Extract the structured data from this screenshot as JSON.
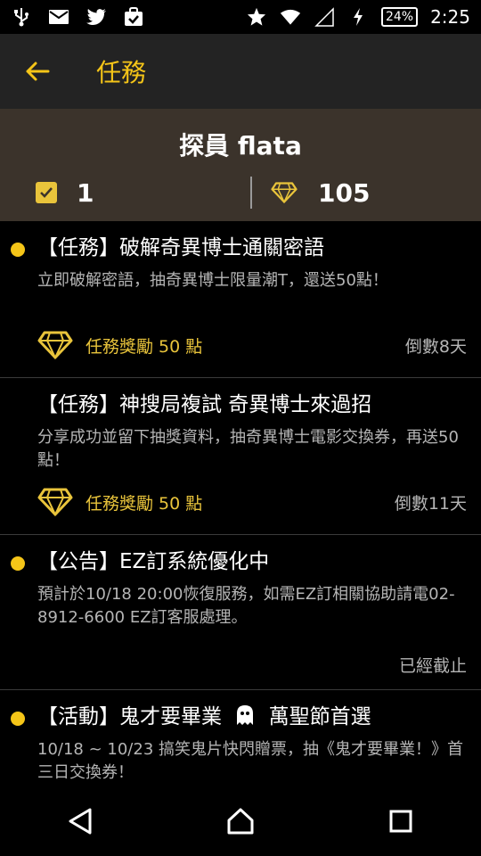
{
  "status_bar": {
    "battery": "24%",
    "time": "2:25"
  },
  "app_bar": {
    "title": "任務"
  },
  "profile": {
    "name": "探員 flata",
    "tasks_count": "1",
    "points": "105"
  },
  "items": [
    {
      "title": "【任務】破解奇異博士通關密語",
      "desc": "立即破解密語，抽奇異博士限量潮T，還送50點！",
      "reward": "任務獎勵 50 點",
      "status": "倒數8天"
    },
    {
      "title": "【任務】神搜局複試 奇異博士來過招",
      "desc": "分享成功並留下抽獎資料，抽奇異博士電影交換券，再送50點！",
      "reward": "任務獎勵 50 點",
      "status": "倒數11天"
    },
    {
      "title": "【公告】EZ訂系統優化中",
      "desc": "預計於10/18 20:00恢復服務，如需EZ訂相關協助請電02-8912-6600 EZ訂客服處理。",
      "status": "已經截止"
    },
    {
      "title_part1": "【活動】鬼才要畢業",
      "title_part2": "萬聖節首選",
      "desc": "10/18 ~ 10/23 搞笑鬼片快閃贈票，抽《鬼才要畢業！》首三日交換券！"
    }
  ],
  "colors": {
    "accent": "#f5c518",
    "app_bar_bg": "#232323",
    "profile_bg": "#3b332b"
  }
}
